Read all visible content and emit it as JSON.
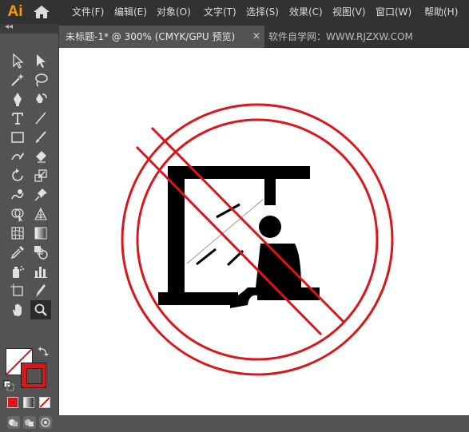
{
  "app": {
    "logo_text": "Ai"
  },
  "menubar": {
    "items": [
      {
        "label": "文件(F)"
      },
      {
        "label": "编辑(E)"
      },
      {
        "label": "对象(O)"
      },
      {
        "label": "文字(T)"
      },
      {
        "label": "选择(S)"
      },
      {
        "label": "效果(C)"
      },
      {
        "label": "视图(V)"
      },
      {
        "label": "窗口(W)"
      },
      {
        "label": "帮助(H)"
      }
    ]
  },
  "tabs": {
    "active": {
      "label": "未标题-1* @ 300% (CMYK/GPU 预览)",
      "close": "×"
    },
    "inactive": {
      "label": "软件自学网：WWW.RJZXW.COM"
    }
  },
  "toolbar": {
    "collapse": "◂◂",
    "tools": [
      {
        "name": "selection-tool-icon"
      },
      {
        "name": "direct-selection-tool-icon"
      },
      {
        "name": "magic-wand-tool-icon"
      },
      {
        "name": "lasso-tool-icon"
      },
      {
        "name": "pen-tool-icon"
      },
      {
        "name": "curvature-tool-icon"
      },
      {
        "name": "type-tool-icon"
      },
      {
        "name": "line-segment-tool-icon"
      },
      {
        "name": "rectangle-tool-icon"
      },
      {
        "name": "paintbrush-tool-icon"
      },
      {
        "name": "shaper-tool-icon"
      },
      {
        "name": "eraser-tool-icon"
      },
      {
        "name": "rotate-tool-icon"
      },
      {
        "name": "scale-tool-icon"
      },
      {
        "name": "warp-tool-icon"
      },
      {
        "name": "puppet-warp-tool-icon"
      },
      {
        "name": "shape-builder-tool-icon"
      },
      {
        "name": "perspective-grid-tool-icon"
      },
      {
        "name": "mesh-tool-icon"
      },
      {
        "name": "gradient-tool-icon"
      },
      {
        "name": "eyedropper-tool-icon"
      },
      {
        "name": "blend-tool-icon"
      },
      {
        "name": "symbol-sprayer-tool-icon"
      },
      {
        "name": "column-graph-tool-icon"
      },
      {
        "name": "artboard-tool-icon"
      },
      {
        "name": "slice-tool-icon"
      },
      {
        "name": "hand-tool-icon"
      },
      {
        "name": "zoom-tool-icon"
      }
    ]
  },
  "colors": {
    "menubar_bg": "#323232",
    "panel_bg": "#535353",
    "logo": "#ff9a00",
    "prohibition_red": "#d9161c",
    "artwork_black": "#000000"
  },
  "canvas": {
    "zoom": "300%",
    "color_mode": "CMYK/GPU 预览"
  }
}
